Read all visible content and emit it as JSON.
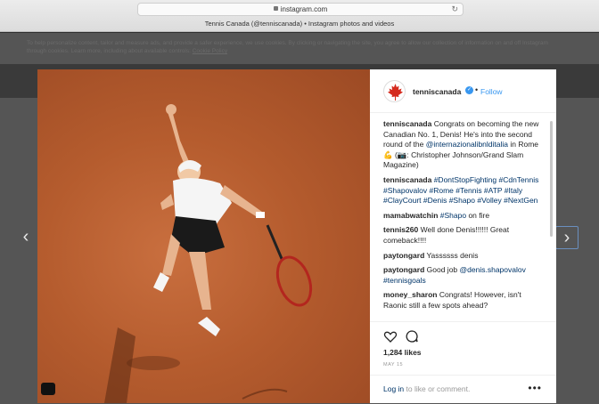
{
  "browser": {
    "url": "instagram.com",
    "tab_title": "Tennis Canada (@tenniscanada) • Instagram photos and videos"
  },
  "cookie_notice": {
    "text": "To help personalize content, tailor and measure ads, and provide a safer experience, we use cookies. By clicking or navigating the site, you agree to allow our collection of information on and off Instagram through cookies. Learn more, including about available controls:",
    "link": "Cookie Policy"
  },
  "navigation": {
    "prev_icon": "chevron-left-icon",
    "next_icon": "chevron-right-icon"
  },
  "post": {
    "username": "tenniscanada",
    "separator": "•",
    "follow_label": "Follow",
    "comments": [
      {
        "user": "tenniscanada",
        "text": "Congrats on becoming the new Canadian No. 1, Denis! He's into the second round of the ",
        "tag": "@internazionalibnlditalia",
        "after": " in Rome 💪 (📷: Christopher Johnson/Grand Slam Magazine)"
      },
      {
        "user": "tenniscanada",
        "text": "",
        "tag": "#DontStopFighting #CdnTennis #Shapovalov #Rome #Tennis #ATP #Italy #ClayCourt #Denis #Shapo #Volley #NextGen",
        "after": ""
      },
      {
        "user": "mamabwatchin",
        "text": "",
        "tag": "#Shapo",
        "after": " on fire"
      },
      {
        "user": "tennis260",
        "text": "Well done Denis!!!!!! Great comeback!!!!",
        "tag": "",
        "after": ""
      },
      {
        "user": "paytongard",
        "text": "Yassssss denis",
        "tag": "",
        "after": ""
      },
      {
        "user": "paytongard",
        "text": "Good job ",
        "tag": "@denis.shapovalov #tennisgoals",
        "after": ""
      },
      {
        "user": "money_sharon",
        "text": "Congrats! However, isn't Raonic still a few spots ahead?",
        "tag": "",
        "after": ""
      }
    ],
    "likes": "1,284 likes",
    "date": "MAY 15",
    "login_link": "Log in",
    "login_text": " to like or comment.",
    "more_label": "•••"
  },
  "colors": {
    "link": "#003569",
    "follow": "#3897f0",
    "clay": "#b55c2e"
  }
}
